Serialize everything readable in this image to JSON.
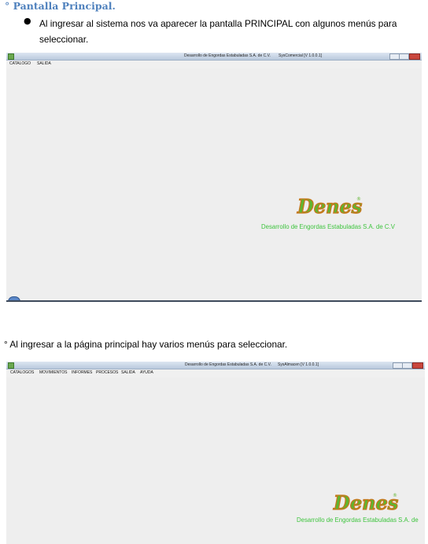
{
  "section": {
    "marker": "°",
    "title": "Pantalla Principal."
  },
  "bullet": {
    "symbol": "●",
    "text": "Al ingresar al sistema nos va aparecer la pantalla PRINCIPAL con algunos menús para seleccionar."
  },
  "paragraph": "° Al ingresar a la página principal hay varios menús para seleccionar.",
  "window1": {
    "title": "Desarrollo de Engordas Estabuladas S.A. de C.V.",
    "version": "SysComercial [V 1.0.0.1]",
    "menu": [
      "CATALOGO",
      "SALIDA"
    ]
  },
  "window2": {
    "title": "Desarrollo de Engordas Estabuladas S.A. de C.V.",
    "version": "SysAlmacen [V 1.0.0.1]",
    "menu": [
      "CATALOGOS",
      "MOVIMIENTOS",
      "INFORMES",
      "PROCESOS",
      "SALIDA",
      "AYUDA"
    ]
  },
  "logo": {
    "brand": "Denes",
    "registered": "®",
    "caption": "Desarrollo de Engordas Estabuladas S.A. de C.V",
    "caption_cropped": "Desarrollo de Engordas Estabuladas S.A. de"
  },
  "colors": {
    "heading": "#4f81bd",
    "logo_fill": "#5fb52f",
    "logo_outline": "#c7781d",
    "caption": "#3ec43e"
  }
}
